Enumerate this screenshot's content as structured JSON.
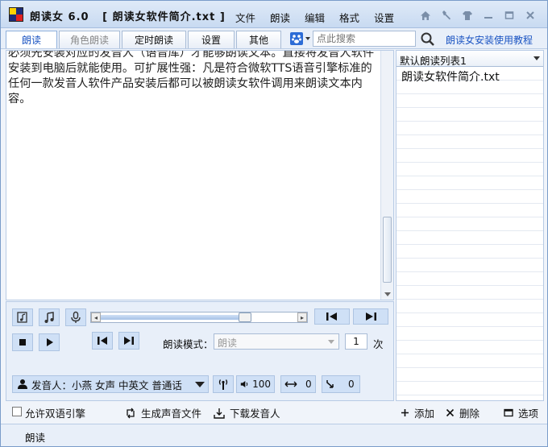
{
  "title": {
    "app": "朗读女 6.0",
    "file": "[ 朗读女软件简介.txt ]"
  },
  "menu": [
    "文件",
    "朗读",
    "编辑",
    "格式",
    "设置"
  ],
  "tabs": [
    {
      "label": "朗读",
      "state": "active"
    },
    {
      "label": "角色朗读",
      "state": "disabled"
    },
    {
      "label": "定时朗读",
      "state": "normal"
    },
    {
      "label": "设置",
      "state": "normal"
    },
    {
      "label": "其他",
      "state": "normal"
    }
  ],
  "search": {
    "placeholder": "点此搜索"
  },
  "tutorial_link": "朗读女安装使用教程",
  "editor": {
    "text": "必须先安装对应的发音人（语音库）才能够朗读文本。直接将发音人软件安装到电脑后就能使用。可扩展性强：凡是符合微软TTS语音引擎标准的任何一款发音人软件产品安装后都可以被朗读女软件调用来朗读文本内容。"
  },
  "playlist": {
    "selected": "默认朗读列表1",
    "items": [
      "朗读女软件简介.txt"
    ]
  },
  "player": {
    "mode_label": "朗读模式：",
    "mode_value": "朗读",
    "repeat_count": "1",
    "repeat_unit": "次",
    "progress": 0.75
  },
  "speaker": {
    "label": "发音人：小燕 女声 中英文 普通话",
    "volume": "100",
    "speed": "0",
    "pitch": "0"
  },
  "bottom": {
    "dual_engine_label": "允许双语引擎",
    "generate_audio": "生成声音文件",
    "download_speaker": "下载发音人",
    "list_add": "添加",
    "list_delete": "删除",
    "list_options": "选项"
  },
  "status": "朗读"
}
